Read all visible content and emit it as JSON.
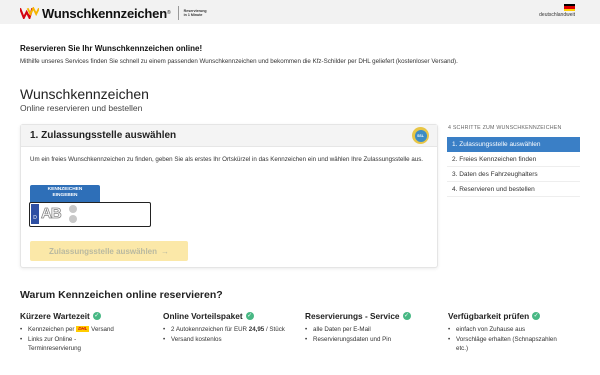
{
  "header": {
    "brand": "Wunschkennzeichen",
    "tagline": [
      "Reservierung",
      "in 1 Minute"
    ],
    "language": "deutschlandweit"
  },
  "intro": {
    "title": "Reservieren Sie Ihr Wunschkennzeichen online!",
    "text": "Mithilfe unseres Services finden Sie schnell zu einem passenden Wunschkennzeichen und bekommen die Kfz-Schilder per DHL geliefert (kostenloser Versand)."
  },
  "page": {
    "title": "Wunschkennzeichen",
    "subtitle": "Online reservieren und bestellen"
  },
  "card": {
    "title": "1. Zulassungsstelle auswählen",
    "badge": "SSL",
    "text": "Um ein freies Wunschkennzeichen zu finden, geben Sie als erstes Ihr Ortskürzel in das Kennzeichen ein und wählen Ihre Zulassungsstelle aus.",
    "plate_tag_line1": "KENNZEICHEN",
    "plate_tag_line2": "EINGEBEN",
    "plate_country": "D",
    "plate_placeholder": "AB",
    "button_label": "Zulassungsstelle auswählen",
    "button_arrow": "→"
  },
  "steps": {
    "title": "4 SCHRITTE ZUM WUNSCHKENNZEICHEN",
    "items": [
      {
        "label": "1. Zulassungsstelle auswählen",
        "active": true
      },
      {
        "label": "2. Freies Kennzeichen finden",
        "active": false
      },
      {
        "label": "3. Daten des Fahrzeughalters",
        "active": false
      },
      {
        "label": "4. Reservieren und bestellen",
        "active": false
      }
    ]
  },
  "why": {
    "title": "Warum Kennzeichen online reservieren?",
    "columns": [
      {
        "title": "Kürzere Wartezeit",
        "items": [
          "Kennzeichen per",
          "Versand",
          "Links zur Online -",
          "Terminreservierung"
        ],
        "dhl": "DHL"
      },
      {
        "title": "Online Vorteilspaket",
        "items": [
          "2 Autokennzeichen für EUR",
          "24,95",
          "/ Stück",
          "Versand kostenlos"
        ]
      },
      {
        "title": "Reservierungs - Service",
        "items": [
          "alle Daten per E-Mail",
          "Reservierungsdaten und Pin"
        ]
      },
      {
        "title": "Verfügbarkeit prüfen",
        "items": [
          "einfach von Zuhause aus",
          "Vorschläge erhalten (Schnapszahlen",
          "etc.)"
        ]
      }
    ]
  },
  "colors": {
    "accent": "#3a7fc6",
    "button_bg": "#fbe8a8",
    "check": "#48b884"
  },
  "icons": {
    "check": "✓"
  }
}
